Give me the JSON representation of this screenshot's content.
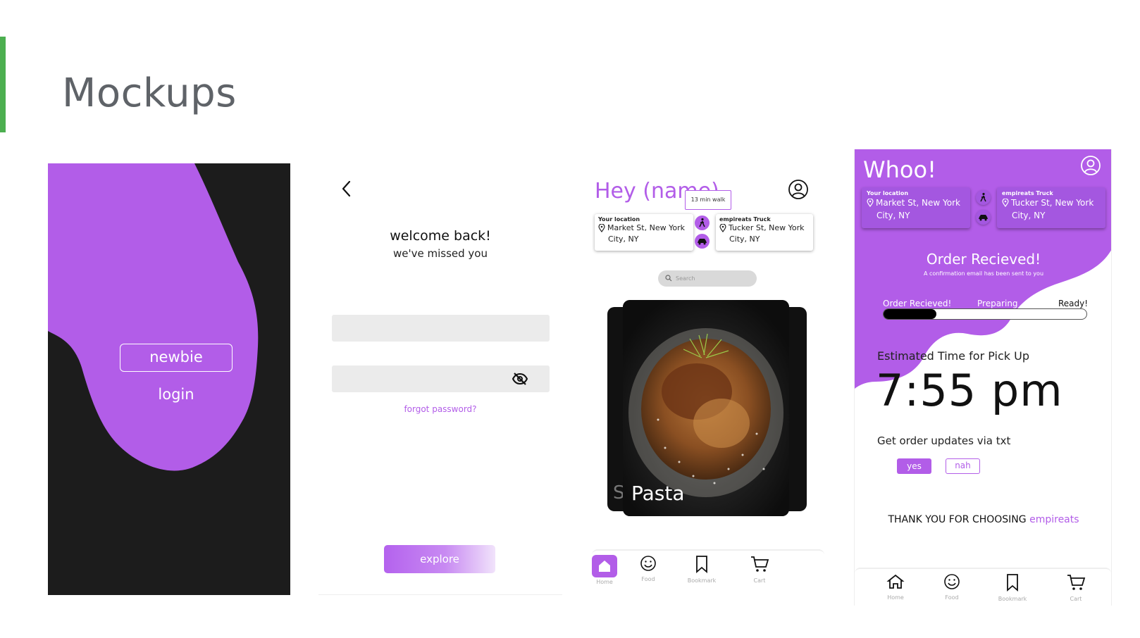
{
  "slide": {
    "title": "Mockups"
  },
  "colors": {
    "brand": "#b25de8",
    "accent_bar": "#4caf50",
    "dark_bg": "#1c1c1c"
  },
  "landing": {
    "newbie_label": "newbie",
    "login_label": "login"
  },
  "login": {
    "welcome": "welcome back!",
    "missed": "we've missed you",
    "forgot_password": "forgot password?",
    "explore_label": "explore",
    "icons": [
      "back-arrow-icon",
      "eye-off-icon"
    ]
  },
  "home": {
    "greeting": "Hey (name)",
    "walk_tooltip": "13 min walk",
    "your_location": {
      "label": "Your location",
      "line1": "Market St, New York",
      "line2": "City, NY"
    },
    "truck_location": {
      "label": "empireats Truck",
      "line1": "Tucker St, New York",
      "line2": "City, NY"
    },
    "search_placeholder": "Search",
    "card_back_letter": "S",
    "food_label": "Pasta",
    "nav": [
      {
        "label": "Home",
        "icon": "home-icon",
        "active": true
      },
      {
        "label": "Food",
        "icon": "smiley-icon",
        "active": false
      },
      {
        "label": "Bookmark",
        "icon": "bookmark-icon",
        "active": false
      },
      {
        "label": "Cart",
        "icon": "cart-icon",
        "active": false
      }
    ]
  },
  "order": {
    "title": "Whoo!",
    "your_location": {
      "label": "Your location",
      "line1": "Market St, New York",
      "line2": "City, NY"
    },
    "truck_location": {
      "label": "empireats Truck",
      "line1": "Tucker St, New York",
      "line2": "City, NY"
    },
    "status_title": "Order Recieved!",
    "status_sub": "A confirmation email has been sent to you",
    "steps": [
      "Order Recieved!",
      "Preparing",
      "Ready!"
    ],
    "progress": 0.26,
    "eta_label": "Estimated Time for Pick Up",
    "eta_time": "7:55 pm",
    "updates_label": "Get order updates via txt",
    "yes_label": "yes",
    "nah_label": "nah",
    "thanks_prefix": "THANK YOU FOR CHOOSING ",
    "thanks_brand": "empireats",
    "nav": [
      {
        "label": "Home",
        "icon": "home-icon"
      },
      {
        "label": "Food",
        "icon": "smiley-icon"
      },
      {
        "label": "Bookmark",
        "icon": "bookmark-icon"
      },
      {
        "label": "Cart",
        "icon": "cart-icon"
      }
    ]
  }
}
